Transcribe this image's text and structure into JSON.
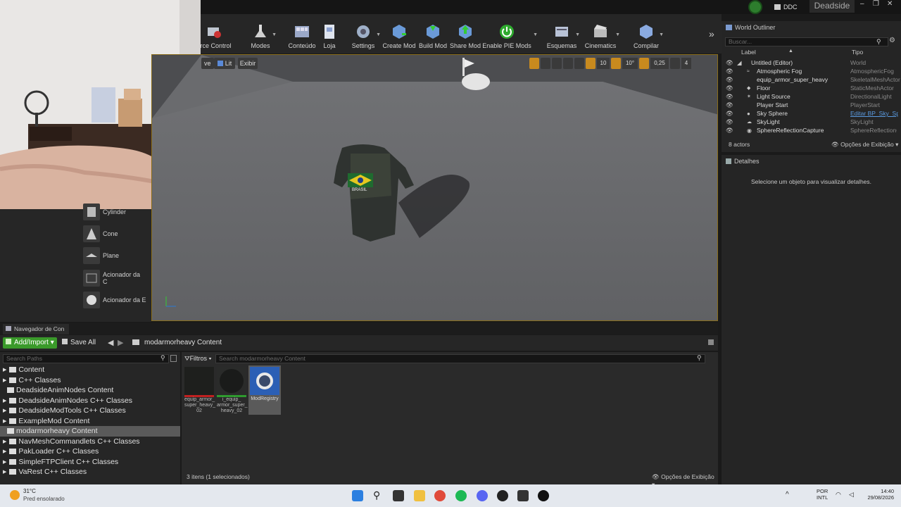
{
  "window": {
    "project_name": "Deadside",
    "ddc_label": "DDC",
    "controls": [
      "–",
      "❐",
      "✕"
    ]
  },
  "toolbar": {
    "items": [
      {
        "label": "urce Control",
        "icon": "source-control-icon"
      },
      {
        "label": "Modes",
        "icon": "modes-icon"
      },
      {
        "label": "Conteúdo",
        "icon": "content-icon"
      },
      {
        "label": "Loja",
        "icon": "marketplace-icon"
      },
      {
        "label": "Settings",
        "icon": "settings-icon"
      },
      {
        "label": "Create Mod",
        "icon": "create-mod-icon"
      },
      {
        "label": "Build Mod",
        "icon": "build-mod-icon"
      },
      {
        "label": "Share Mod",
        "icon": "share-mod-icon"
      },
      {
        "label": "Enable PIE Mods",
        "icon": "enable-pie-icon"
      },
      {
        "label": "Esquemas",
        "icon": "blueprints-icon"
      },
      {
        "label": "Cinematics",
        "icon": "cinematics-icon"
      },
      {
        "label": "Compilar",
        "icon": "build-icon"
      }
    ],
    "more": "»"
  },
  "viewport": {
    "perspective": "ve",
    "lit": "Lit",
    "show": "Exibir",
    "grid_snap": "10",
    "rot_snap": "10°",
    "scale_snap": "0,25",
    "camera_speed": "4",
    "vest_label": "BRASIL"
  },
  "place_panel": {
    "items": [
      "Cylinder",
      "Cone",
      "Plane",
      "Acionador da C",
      "Acionador da E"
    ]
  },
  "outliner": {
    "tab": "World Outliner",
    "search_placeholder": "Buscar...",
    "col_label": "Label",
    "col_type": "Tipo",
    "rows": [
      {
        "label": "Untitled (Editor)",
        "type": "World"
      },
      {
        "label": "Atmospheric Fog",
        "type": "AtmosphericFog"
      },
      {
        "label": "equip_armor_super_heavy",
        "type": "SkeletalMeshActor"
      },
      {
        "label": "Floor",
        "type": "StaticMeshActor"
      },
      {
        "label": "Light Source",
        "type": "DirectionalLight"
      },
      {
        "label": "Player Start",
        "type": "PlayerStart"
      },
      {
        "label": "Sky Sphere",
        "type": "Editar BP_Sky_Sp"
      },
      {
        "label": "SkyLight",
        "type": "SkyLight"
      },
      {
        "label": "SphereReflectionCapture",
        "type": "SphereReflectionC"
      }
    ],
    "count": "8 actors",
    "view_options": "Opções de Exibição"
  },
  "details": {
    "tab": "Detalhes",
    "empty_msg": "Selecione um objeto para visualizar detalhes."
  },
  "content_browser": {
    "tab": "Navegador de Con",
    "add_import": "Add/Import",
    "save_all": "Save All",
    "path": "modarmorheavy Content",
    "search_paths_placeholder": "Search Paths",
    "filters": "Filtros",
    "search_placeholder": "Search modarmorheavy Content",
    "tree": [
      {
        "label": "Content",
        "expanded": false
      },
      {
        "label": "C++ Classes",
        "expanded": false
      },
      {
        "label": "DeadsideAnimNodes Content",
        "expanded": false
      },
      {
        "label": "DeadsideAnimNodes C++ Classes",
        "expanded": false
      },
      {
        "label": "DeadsideModTools C++ Classes",
        "expanded": false
      },
      {
        "label": "ExampleMod Content",
        "expanded": false
      },
      {
        "label": "modarmorheavy Content",
        "expanded": false
      },
      {
        "label": "NavMeshCommandlets C++ Classes",
        "expanded": false
      },
      {
        "label": "PakLoader C++ Classes",
        "expanded": false
      },
      {
        "label": "SimpleFTPClient C++ Classes",
        "expanded": false
      },
      {
        "label": "VaRest C++ Classes",
        "expanded": false
      }
    ],
    "assets": [
      {
        "label": "equip_armor_super_heavy_02",
        "line1": "equip_armor_",
        "line2": "super_heavy_",
        "line3": "02"
      },
      {
        "label": "i_equip_armor_super_heavy_02",
        "line1": "i_equip_",
        "line2": "armor_super_",
        "line3": "heavy_02"
      },
      {
        "label": "ModRegistry",
        "line1": "ModRegistry",
        "line2": "",
        "line3": ""
      }
    ],
    "status": "3 itens (1 selecionados)",
    "view_options": "Opções de Exibição"
  },
  "taskbar": {
    "temp": "31°C",
    "weather": "Pred ensolarado",
    "lang1": "POR",
    "lang2": "INTL",
    "time": "14:40",
    "date": "29/08/2026"
  }
}
